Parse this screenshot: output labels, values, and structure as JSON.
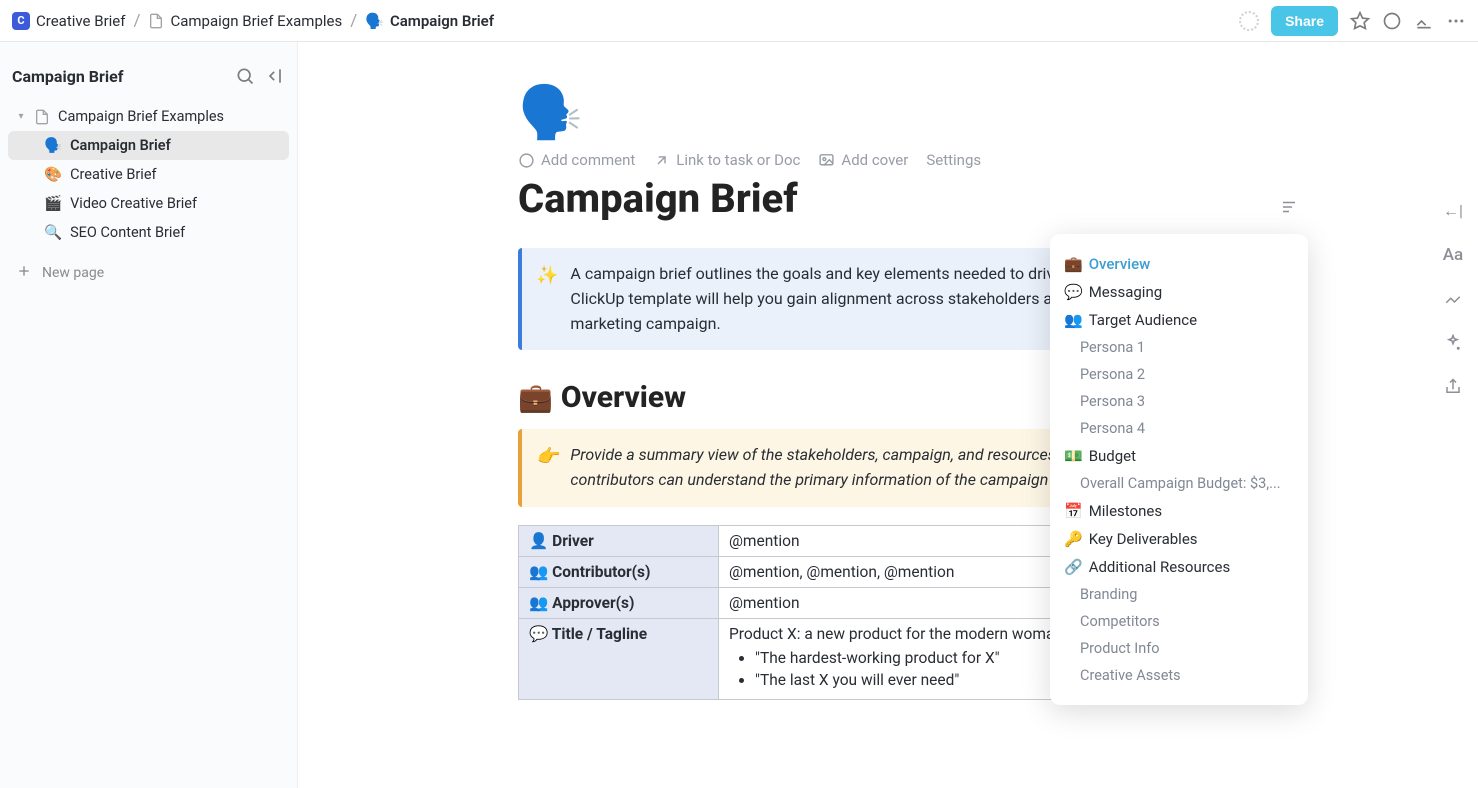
{
  "breadcrumb": {
    "app_badge": "C",
    "root": "Creative Brief",
    "mid": "Campaign Brief Examples",
    "current_icon": "🗣️",
    "current": "Campaign Brief"
  },
  "topbar": {
    "share_label": "Share"
  },
  "sidebar": {
    "title": "Campaign Brief",
    "root_item": {
      "label": "Campaign Brief Examples",
      "icon": "📄"
    },
    "items": [
      {
        "icon": "🗣️",
        "label": "Campaign Brief",
        "active": true
      },
      {
        "icon": "🎨",
        "label": "Creative Brief",
        "active": false
      },
      {
        "icon": "🎬",
        "label": "Video Creative Brief",
        "active": false
      },
      {
        "icon": "🔍",
        "label": "SEO Content Brief",
        "active": false
      }
    ],
    "new_page_label": "New page"
  },
  "page": {
    "icon": "🗣️",
    "actions": {
      "comment": "Add comment",
      "link_task": "Link to task or Doc",
      "cover": "Add cover",
      "settings": "Settings"
    },
    "title": "Campaign Brief",
    "intro_callout": "A campaign brief outlines the goals and key elements needed to drive a successful campaign. This ClickUp template will help you gain alignment across stakeholders and successfully kick off any marketing campaign.",
    "overview": {
      "heading_icon": "💼",
      "heading": "Overview",
      "callout_icon": "👉",
      "callout": "Provide a summary view of the stakeholders, campaign, and resources. Leadership, stakeholders, and contributors can understand the primary information of the campaign at a glance.",
      "rows": [
        {
          "icon": "👤",
          "label": "Driver",
          "value": "@mention"
        },
        {
          "icon": "👥",
          "label": "Contributor(s)",
          "value": "@mention, @mention, @mention"
        },
        {
          "icon": "👥",
          "label": "Approver(s)",
          "value": "@mention"
        }
      ],
      "title_row": {
        "icon": "💬",
        "label": "Title / Tagline",
        "headline": "Product X: a new product for the modern woman",
        "bullets": [
          "\"The hardest-working product for X\"",
          "\"The last X you will ever need\""
        ]
      }
    }
  },
  "toc": {
    "items": [
      {
        "icon": "💼",
        "label": "Overview",
        "active": true
      },
      {
        "icon": "💬",
        "label": "Messaging"
      },
      {
        "icon": "👥",
        "label": "Target Audience",
        "subs": [
          "Persona 1",
          "Persona 2",
          "Persona 3",
          "Persona 4"
        ]
      },
      {
        "icon": "💵",
        "label": "Budget",
        "subs": [
          "Overall Campaign Budget: $3,..."
        ]
      },
      {
        "icon": "📅",
        "label": "Milestones"
      },
      {
        "icon": "🔑",
        "label": "Key Deliverables"
      },
      {
        "icon": "🔗",
        "label": "Additional Resources",
        "subs": [
          "Branding",
          "Competitors",
          "Product Info",
          "Creative Assets"
        ]
      }
    ]
  }
}
